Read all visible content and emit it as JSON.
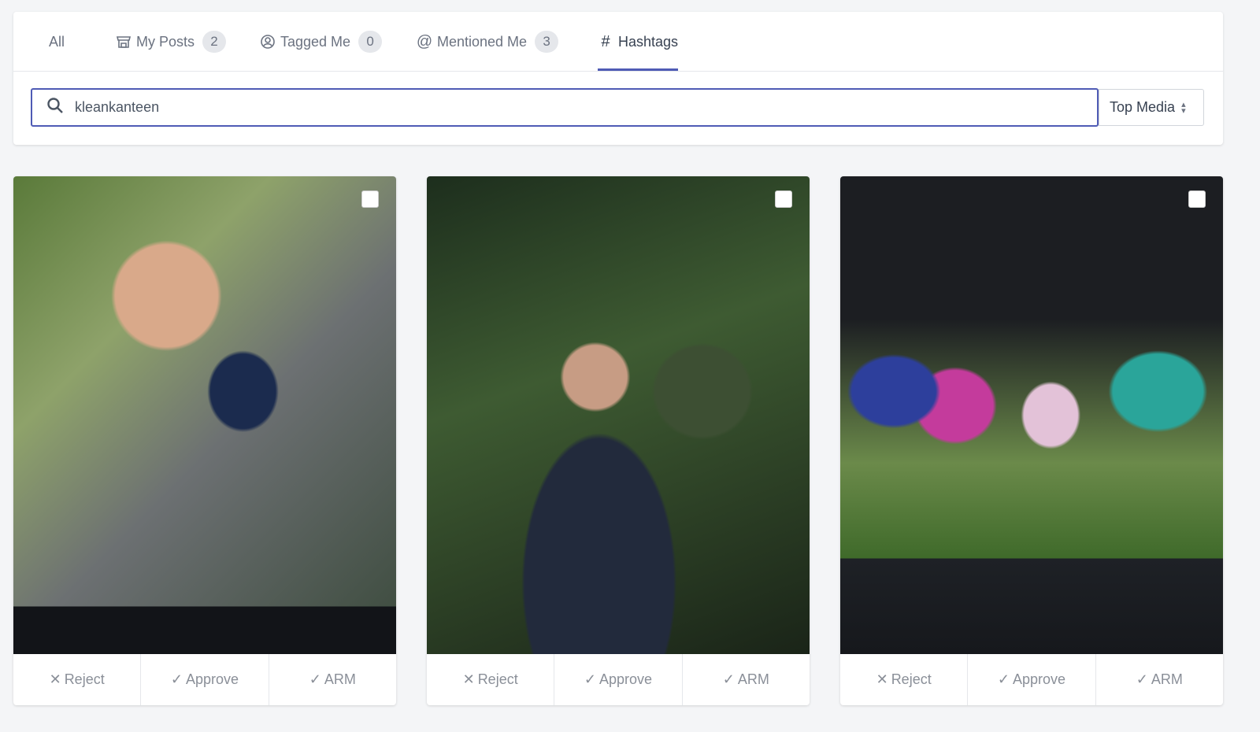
{
  "tabs": [
    {
      "label": "All",
      "icon": "none"
    },
    {
      "label": "My Posts",
      "count": "2",
      "icon": "store-icon"
    },
    {
      "label": "Tagged Me",
      "count": "0",
      "icon": "user-circle-icon"
    },
    {
      "label": "Mentioned Me",
      "count": "3",
      "icon": "at-icon"
    },
    {
      "label": "Hashtags",
      "icon": "hashtag-icon",
      "active": true
    }
  ],
  "search": {
    "value": "kleankanteen",
    "icon": "search-icon"
  },
  "sort": {
    "selected": "Top Media"
  },
  "accent": "#4f5bb5",
  "cards": [
    {
      "image": "Man holding Klean Kanteen insulated bottle",
      "actions": {
        "reject": "Reject",
        "approve": "Approve",
        "arm": "ARM"
      }
    },
    {
      "image": "Woman holding green Klean Kanteen bottle",
      "actions": {
        "reject": "Reject",
        "approve": "Approve",
        "arm": "ARM"
      }
    },
    {
      "image": "Colorful Klean Kanteen kids bottles on grass",
      "actions": {
        "reject": "Reject",
        "approve": "Approve",
        "arm": "ARM"
      }
    }
  ]
}
